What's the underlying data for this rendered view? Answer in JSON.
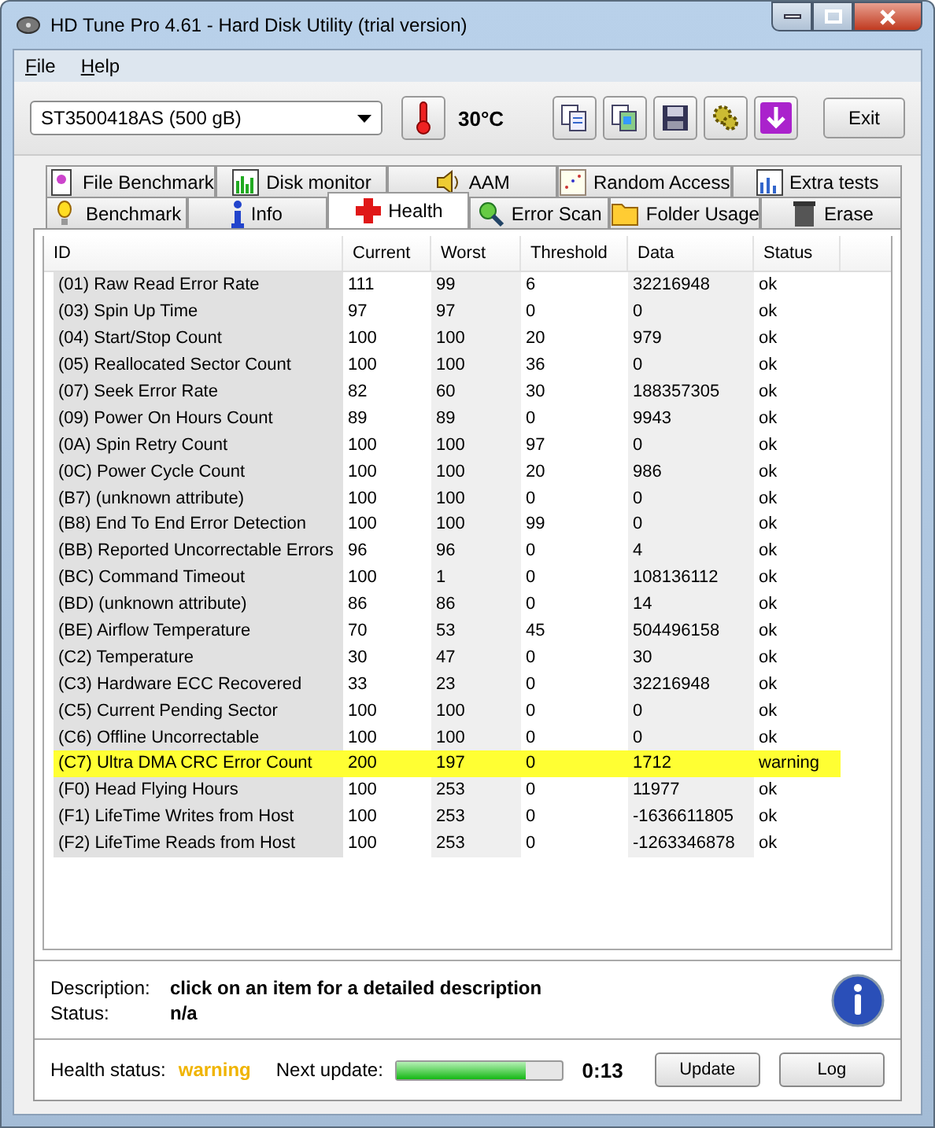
{
  "window": {
    "title": "HD Tune Pro 4.61 - Hard Disk Utility (trial version)"
  },
  "menu": [
    {
      "label": "File"
    },
    {
      "label": "Help"
    }
  ],
  "toolbar": {
    "drive": "ST3500418AS (500 gB)",
    "temperature": "30°C",
    "exit": "Exit"
  },
  "tab_rows": [
    [
      {
        "label": "File Benchmark",
        "selected": false
      },
      {
        "label": "Disk monitor",
        "selected": false
      },
      {
        "label": "AAM",
        "selected": false
      },
      {
        "label": "Random Access",
        "selected": false
      },
      {
        "label": "Extra tests",
        "selected": false
      }
    ],
    [
      {
        "label": "Benchmark",
        "selected": false
      },
      {
        "label": "Info",
        "selected": false
      },
      {
        "label": "Health",
        "selected": true
      },
      {
        "label": "Error Scan",
        "selected": false
      },
      {
        "label": "Folder Usage",
        "selected": false
      },
      {
        "label": "Erase",
        "selected": false
      }
    ]
  ],
  "table": {
    "columns": [
      "ID",
      "Current",
      "Worst",
      "Threshold",
      "Data",
      "Status"
    ],
    "rows": [
      {
        "cells": [
          "(01) Raw Read Error Rate",
          "111",
          "99",
          "6",
          "32216948",
          "ok"
        ],
        "highlighted": false
      },
      {
        "cells": [
          "(03) Spin Up Time",
          "97",
          "97",
          "0",
          "0",
          "ok"
        ],
        "highlighted": false
      },
      {
        "cells": [
          "(04) Start/Stop Count",
          "100",
          "100",
          "20",
          "979",
          "ok"
        ],
        "highlighted": false
      },
      {
        "cells": [
          "(05) Reallocated Sector Count",
          "100",
          "100",
          "36",
          "0",
          "ok"
        ],
        "highlighted": false
      },
      {
        "cells": [
          "(07) Seek Error Rate",
          "82",
          "60",
          "30",
          "188357305",
          "ok"
        ],
        "highlighted": false
      },
      {
        "cells": [
          "(09) Power On Hours Count",
          "89",
          "89",
          "0",
          "9943",
          "ok"
        ],
        "highlighted": false
      },
      {
        "cells": [
          "(0A) Spin Retry Count",
          "100",
          "100",
          "97",
          "0",
          "ok"
        ],
        "highlighted": false
      },
      {
        "cells": [
          "(0C) Power Cycle Count",
          "100",
          "100",
          "20",
          "986",
          "ok"
        ],
        "highlighted": false
      },
      {
        "cells": [
          "(B7) (unknown attribute)",
          "100",
          "100",
          "0",
          "0",
          "ok"
        ],
        "highlighted": false
      },
      {
        "cells": [
          "(B8) End To End Error Detection",
          "100",
          "100",
          "99",
          "0",
          "ok"
        ],
        "highlighted": false
      },
      {
        "cells": [
          "(BB) Reported Uncorrectable Errors",
          "96",
          "96",
          "0",
          "4",
          "ok"
        ],
        "highlighted": false
      },
      {
        "cells": [
          "(BC) Command Timeout",
          "100",
          "1",
          "0",
          "108136112",
          "ok"
        ],
        "highlighted": false
      },
      {
        "cells": [
          "(BD) (unknown attribute)",
          "86",
          "86",
          "0",
          "14",
          "ok"
        ],
        "highlighted": false
      },
      {
        "cells": [
          "(BE) Airflow Temperature",
          "70",
          "53",
          "45",
          "504496158",
          "ok"
        ],
        "highlighted": false
      },
      {
        "cells": [
          "(C2) Temperature",
          "30",
          "47",
          "0",
          "30",
          "ok"
        ],
        "highlighted": false
      },
      {
        "cells": [
          "(C3) Hardware ECC Recovered",
          "33",
          "23",
          "0",
          "32216948",
          "ok"
        ],
        "highlighted": false
      },
      {
        "cells": [
          "(C5) Current Pending Sector",
          "100",
          "100",
          "0",
          "0",
          "ok"
        ],
        "highlighted": false
      },
      {
        "cells": [
          "(C6) Offline Uncorrectable",
          "100",
          "100",
          "0",
          "0",
          "ok"
        ],
        "highlighted": false
      },
      {
        "cells": [
          "(C7) Ultra DMA CRC Error Count",
          "200",
          "197",
          "0",
          "1712",
          "warning"
        ],
        "highlighted": true
      },
      {
        "cells": [
          "(F0) Head Flying Hours",
          "100",
          "253",
          "0",
          "11977",
          "ok"
        ],
        "highlighted": false
      },
      {
        "cells": [
          "(F1) LifeTime Writes from Host",
          "100",
          "253",
          "0",
          "-1636611805",
          "ok"
        ],
        "highlighted": false
      },
      {
        "cells": [
          "(F2) LifeTime Reads from Host",
          "100",
          "253",
          "0",
          "-1263346878",
          "ok"
        ],
        "highlighted": false
      }
    ]
  },
  "details": [
    {
      "label": "Description:",
      "value": "click on an item for a detailed description"
    },
    {
      "label": "Status:",
      "value": "n/a"
    }
  ],
  "footer": {
    "health_label": "Health status:",
    "health_value": "warning",
    "health_warning": true,
    "next_label": "Next update:",
    "level": 0.78,
    "countdown": "0:13",
    "buttons": [
      "Update",
      "Log"
    ]
  }
}
